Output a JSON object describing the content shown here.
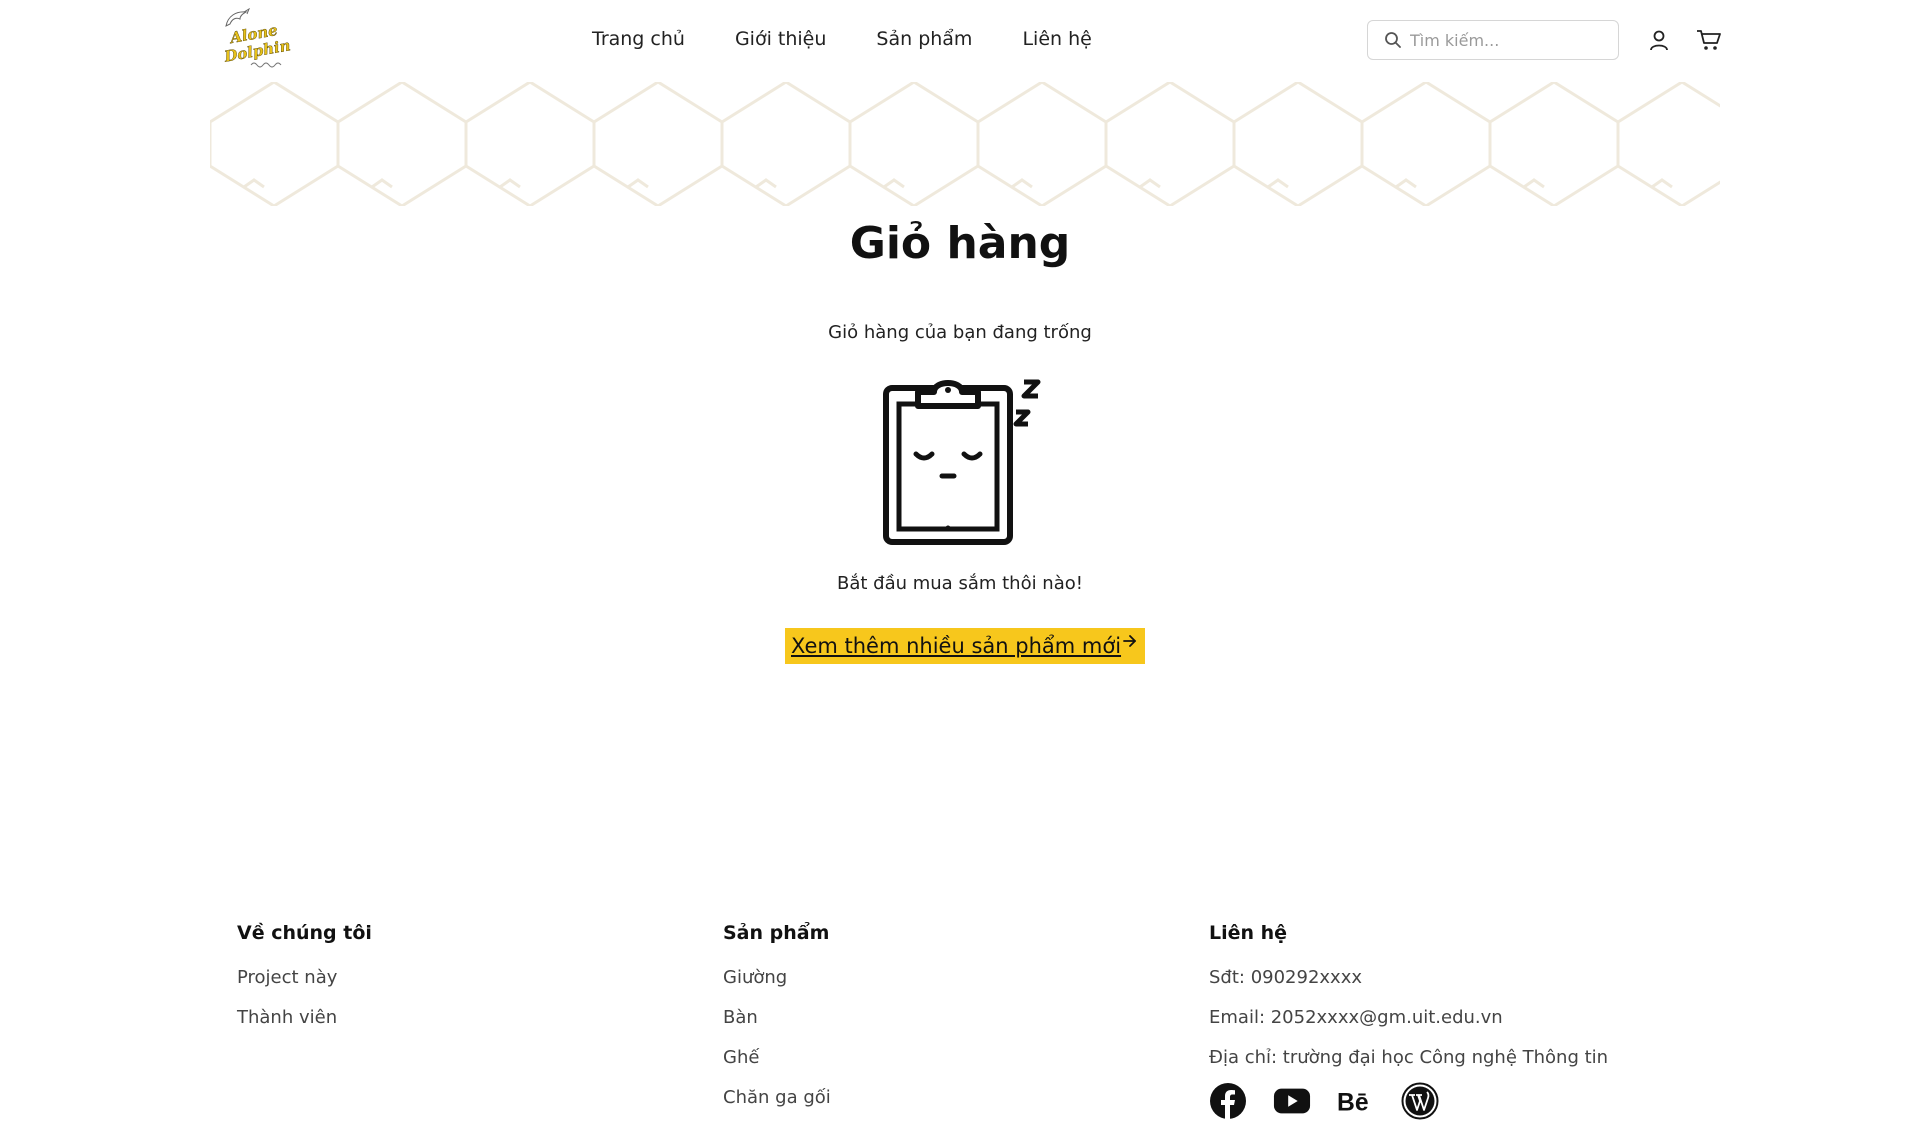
{
  "header": {
    "logo": {
      "line1": "Alone",
      "line2": "Dolphin"
    },
    "nav": [
      {
        "label": "Trang chủ"
      },
      {
        "label": "Giới thiệu"
      },
      {
        "label": "Sản phẩm"
      },
      {
        "label": "Liên hệ"
      }
    ],
    "search": {
      "placeholder": "Tìm kiếm...",
      "value": "",
      "icon": "search-icon"
    },
    "user_icon": "user-icon",
    "cart_icon": "cart-icon"
  },
  "main": {
    "title": "Giỏ hàng",
    "empty_message": "Giỏ hàng của bạn đang trống",
    "illustration": "sleeping-clipboard-icon",
    "start_message": "Bắt đầu mua sắm thôi nào!",
    "cta_label": "Xem thêm nhiều sản phẩm mới",
    "cta_icon": "arrow-right-icon"
  },
  "footer": {
    "about": {
      "heading": "Về chúng tôi",
      "links": [
        "Project này",
        "Thành viên"
      ]
    },
    "products": {
      "heading": "Sản phẩm",
      "links": [
        "Giường",
        "Bàn",
        "Ghế",
        "Chăn ga gối"
      ]
    },
    "contact": {
      "heading": "Liên hệ",
      "phone": "Sđt: 090292xxxx",
      "email": "Email: 2052xxxx@gm.uit.edu.vn",
      "address": "Địa chỉ: trường đại học Công nghệ Thông tin",
      "socials": [
        "facebook-icon",
        "youtube-icon",
        "behance-icon",
        "wordpress-icon"
      ]
    }
  },
  "colors": {
    "accent": "#f7c71c",
    "pattern": "#f1ece0",
    "text": "#111111"
  }
}
